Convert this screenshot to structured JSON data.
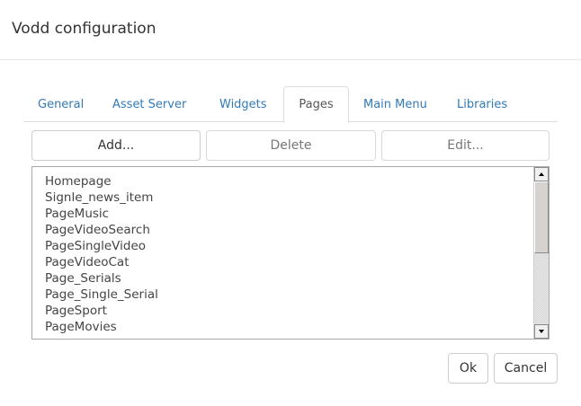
{
  "dialog": {
    "title": "Vodd configuration"
  },
  "tabs": [
    {
      "label": "General",
      "active": false
    },
    {
      "label": "Asset Server",
      "active": false
    },
    {
      "label": "Widgets",
      "active": false
    },
    {
      "label": "Pages",
      "active": true
    },
    {
      "label": "Main Menu",
      "active": false
    },
    {
      "label": "Libraries",
      "active": false
    }
  ],
  "toolbar": {
    "add_label": "Add...",
    "delete_label": "Delete",
    "edit_label": "Edit..."
  },
  "pages_list": {
    "items": [
      "Homepage",
      "Signle_news_item",
      "PageMusic",
      "PageVideoSearch",
      "PageSingleVideo",
      "PageVideoCat",
      "Page_Serials",
      "Page_Single_Serial",
      "PageSport",
      "PageMovies"
    ]
  },
  "footer": {
    "ok_label": "Ok",
    "cancel_label": "Cancel"
  },
  "colors": {
    "tab_link": "#337ab7",
    "active_tab_text": "#555555",
    "border": "#dddddd"
  }
}
